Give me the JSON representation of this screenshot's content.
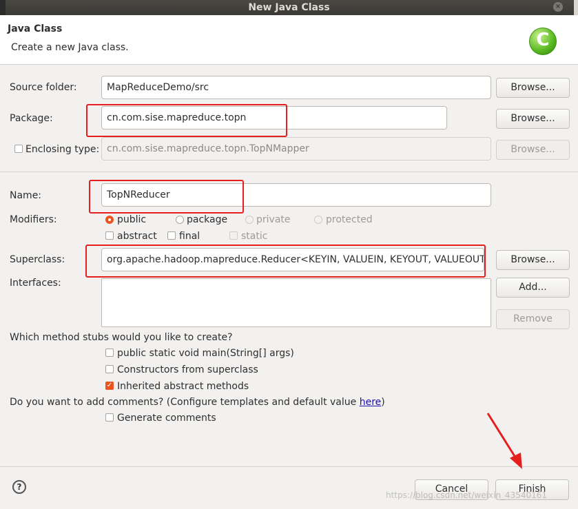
{
  "window": {
    "title": "New Java Class",
    "close_glyph": "×"
  },
  "header": {
    "title": "Java Class",
    "subtitle": "Create a new Java class.",
    "logo_letter": "C"
  },
  "source_folder": {
    "label": "Source folder:",
    "value": "MapReduceDemo/src",
    "browse": "Browse..."
  },
  "package": {
    "label": "Package:",
    "value": "cn.com.sise.mapreduce.topn",
    "browse": "Browse..."
  },
  "enclosing": {
    "label": "Enclosing type:",
    "value": "cn.com.sise.mapreduce.topn.TopNMapper",
    "browse": "Browse..."
  },
  "name": {
    "label": "Name:",
    "value": "TopNReducer"
  },
  "modifiers": {
    "label": "Modifiers:",
    "access": [
      "public",
      "package",
      "private",
      "protected"
    ],
    "selected": "public",
    "flags": [
      "abstract",
      "final",
      "static"
    ]
  },
  "superclass": {
    "label": "Superclass:",
    "value": "org.apache.hadoop.mapreduce.Reducer<KEYIN, VALUEIN, KEYOUT, VALUEOUT>",
    "browse": "Browse..."
  },
  "interfaces": {
    "label": "Interfaces:",
    "add": "Add...",
    "remove": "Remove"
  },
  "stubs": {
    "question": "Which method stubs would you like to create?",
    "options": [
      "public static void main(String[] args)",
      "Constructors from superclass",
      "Inherited abstract methods"
    ],
    "checked": [
      false,
      false,
      true
    ]
  },
  "comments": {
    "question_prefix": "Do you want to add comments? (Configure templates and default value ",
    "link": "here",
    "question_suffix": ")",
    "option": "Generate comments"
  },
  "footer": {
    "help": "?",
    "cancel": "Cancel",
    "finish": "Finish"
  },
  "watermark": "https://blog.csdn.net/weixin_43540161",
  "colors": {
    "accent": "#e95420",
    "annotation": "#e51e1e"
  }
}
